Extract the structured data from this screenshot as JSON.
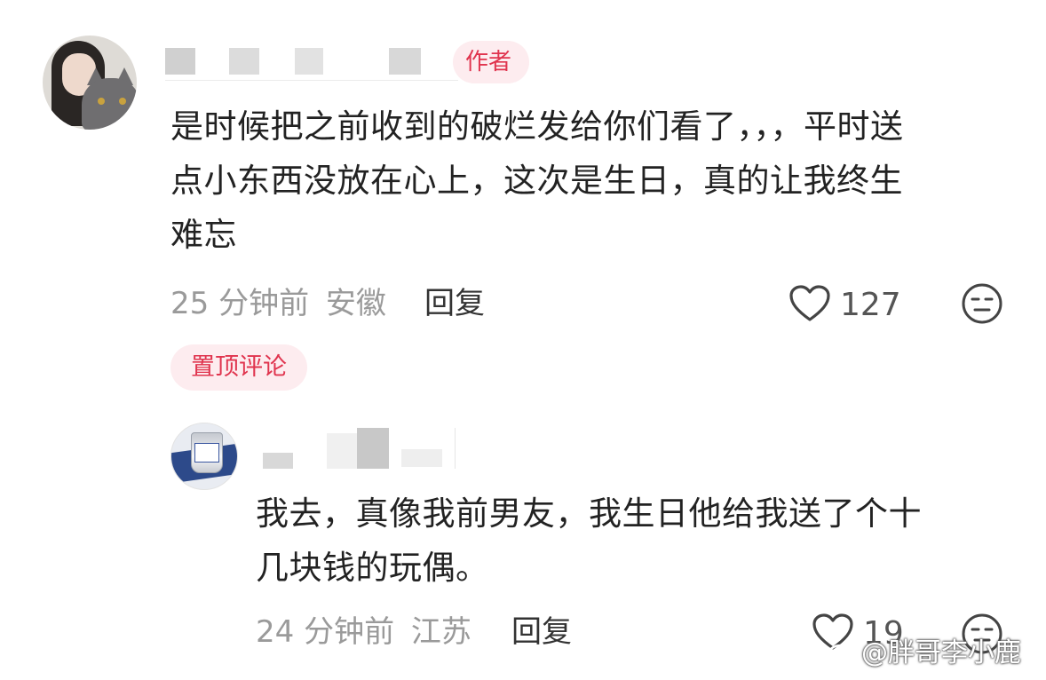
{
  "comments": [
    {
      "author_badge": "作者",
      "text": "是时候把之前收到的破烂发给你们看了，，，平时送\n点小东西没放在心上，这次是生日，真的让我终生\n难忘",
      "time": "25 分钟前",
      "location": "安徽",
      "reply_label": "回复",
      "likes": "127"
    },
    {
      "text": "我去，真像我前男友，我生日他给我送了个十\n几块钱的玩偶。",
      "time": "24 分钟前",
      "location": "江苏",
      "reply_label": "回复",
      "likes": "19"
    }
  ],
  "pinned_label": "置顶评论",
  "watermark": "@胖哥李小鹿",
  "icons": {
    "like": "heart-outline-icon",
    "dislike": "neutral-face-icon",
    "watermark_logo": "weibo-logo-icon"
  },
  "colors": {
    "accent_red": "#e0344e",
    "badge_bg": "#fdecef",
    "meta_gray": "#9a9a9a"
  }
}
